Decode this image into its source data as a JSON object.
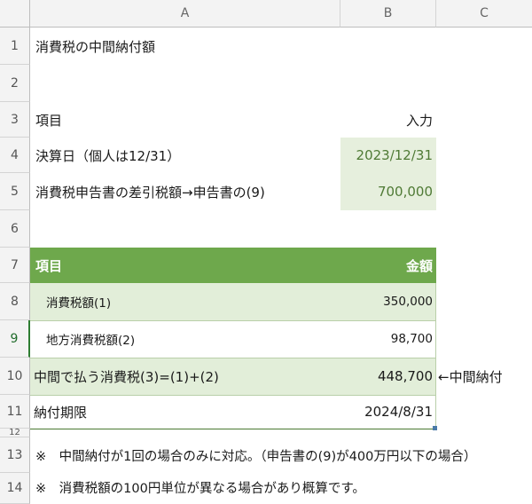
{
  "columns": [
    "A",
    "B",
    "C"
  ],
  "rows": [
    "1",
    "2",
    "3",
    "4",
    "5",
    "6",
    "7",
    "8",
    "9",
    "10",
    "11",
    "12",
    "13",
    "14"
  ],
  "title": "消費税の中間納付額",
  "labels": {
    "item": "項目",
    "input": "入力",
    "closing_date_label": "決算日（個人は12/31）",
    "closing_date_value": "2023/12/31",
    "deduction_label": "消費税申告書の差引税額→申告書の(9)",
    "deduction_value": "700,000"
  },
  "table": {
    "header_item": "項目",
    "header_amount": "金額",
    "rows": [
      {
        "label": "消費税額(1)",
        "value": "350,000"
      },
      {
        "label": "地方消費税額(2)",
        "value": "98,700"
      },
      {
        "label": "中間で払う消費税(3)=(1)+(2)",
        "value": "448,700",
        "note": "←中間納付"
      },
      {
        "label": "納付期限",
        "value": "2024/8/31"
      }
    ]
  },
  "notes": [
    "※　中間納付が1回の場合のみに対応。（申告書の(9)が400万円以下の場合）",
    "※　消費税額の100円単位が異なる場合があり概算です。"
  ],
  "colors": {
    "header_green": "#6ea84c",
    "light_green": "#e2eed9",
    "input_text": "#4f7a35"
  }
}
